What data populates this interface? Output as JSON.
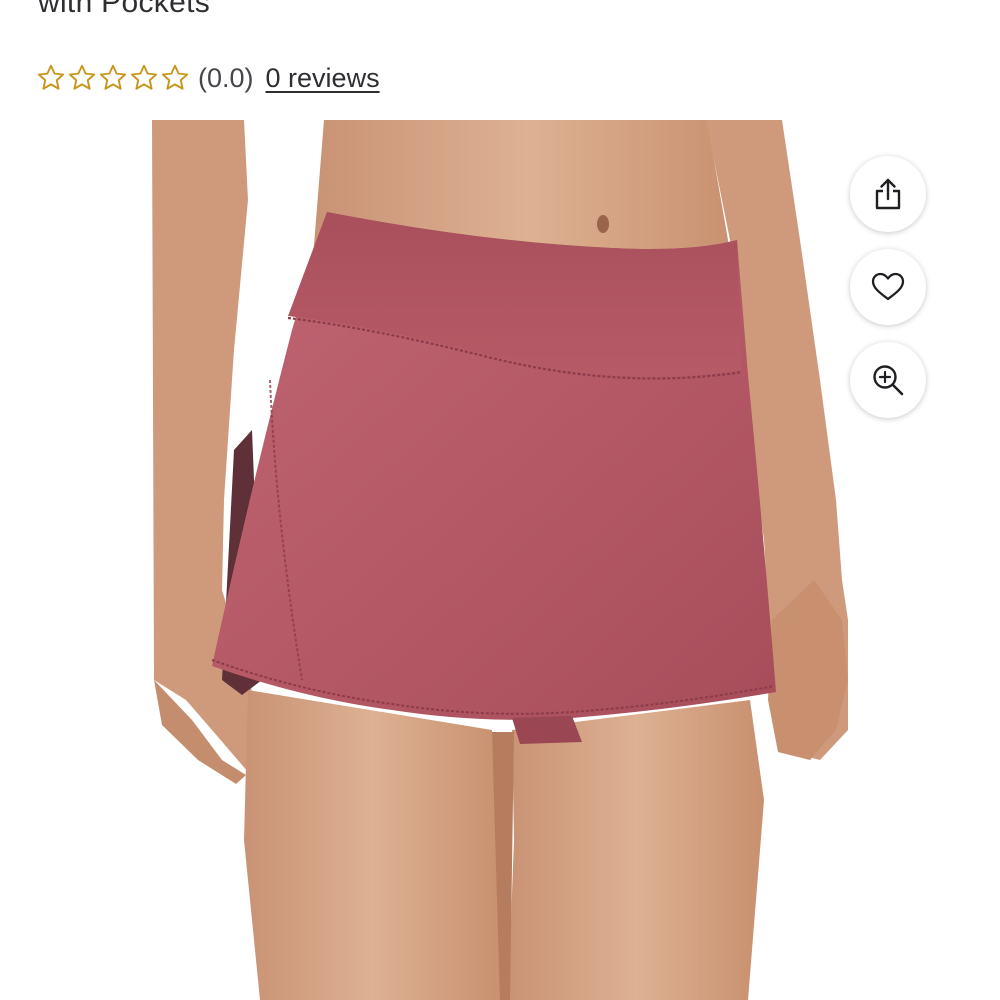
{
  "product": {
    "title_fragment": "with Pockets"
  },
  "rating": {
    "stars_total": 5,
    "stars_filled": 0,
    "value_text": "(0.0)",
    "reviews_text": "0 reviews",
    "star_color": "#c8961e"
  },
  "image": {
    "alt": "Pink athletic skort worn by a model"
  },
  "actions": [
    {
      "name": "share-button",
      "icon": "share-icon",
      "label": "Share"
    },
    {
      "name": "favorite-button",
      "icon": "heart-icon",
      "label": "Add to favorites"
    },
    {
      "name": "zoom-button",
      "icon": "zoom-in-icon",
      "label": "Zoom"
    }
  ],
  "colors": {
    "skort": "#b25561",
    "text": "#2e2f32"
  }
}
